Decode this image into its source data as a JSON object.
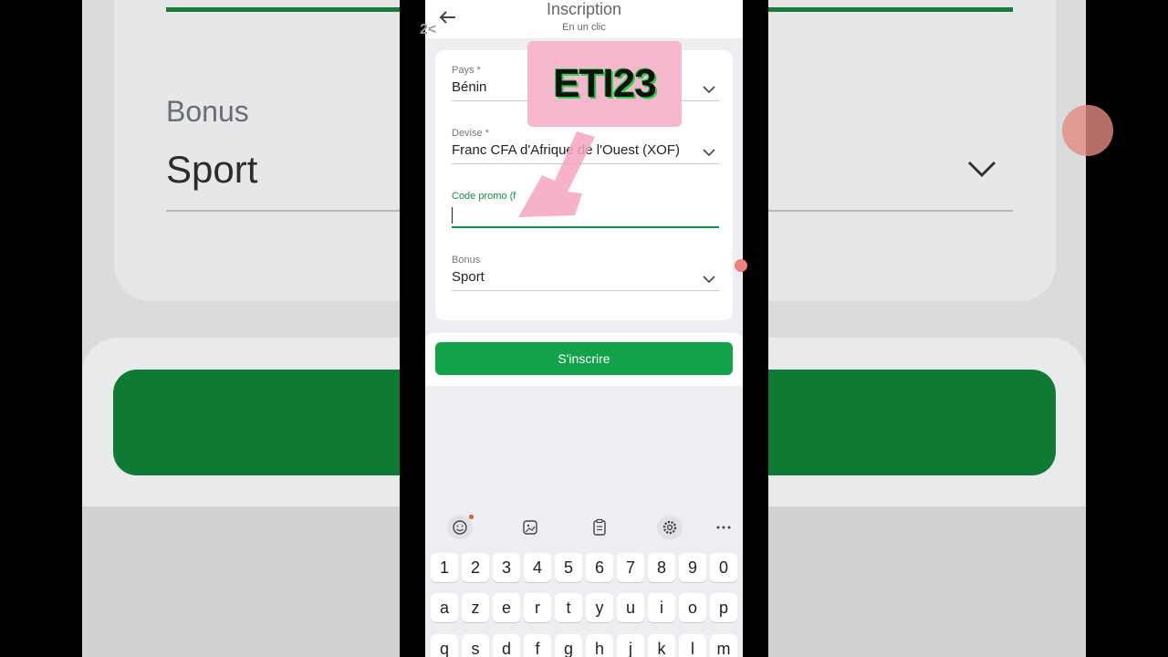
{
  "background": {
    "bonus_label": "Bonus",
    "bonus_value": "Sport"
  },
  "header": {
    "title": "Inscription",
    "subtitle": "En un clic"
  },
  "form": {
    "country": {
      "label": "Pays *",
      "value": "Bénin"
    },
    "currency": {
      "label": "Devise *",
      "value": "Franc CFA d'Afrique de l'Ouest (XOF)"
    },
    "promo": {
      "label": "Code promo (f",
      "value": ""
    },
    "bonus": {
      "label": "Bonus",
      "value": "Sport"
    }
  },
  "submit": {
    "label": "S'inscrire"
  },
  "overlay": {
    "promo_code": "ETI23",
    "watermark": "2<"
  },
  "keyboard": {
    "toolbar": [
      "emoji-icon",
      "sticker-icon",
      "clipboard-icon",
      "gear-icon",
      "more-icon"
    ],
    "row_numbers": [
      "1",
      "2",
      "3",
      "4",
      "5",
      "6",
      "7",
      "8",
      "9",
      "0"
    ],
    "row_azerty1": [
      "a",
      "z",
      "e",
      "r",
      "t",
      "y",
      "u",
      "i",
      "o",
      "p"
    ],
    "row_azerty2": [
      "q",
      "s",
      "d",
      "f",
      "g",
      "h",
      "j",
      "k",
      "l",
      "m"
    ]
  },
  "colors": {
    "primary_green": "#12a34a",
    "active_green": "#1a8a45",
    "promo_pink": "#f6b7cf"
  }
}
